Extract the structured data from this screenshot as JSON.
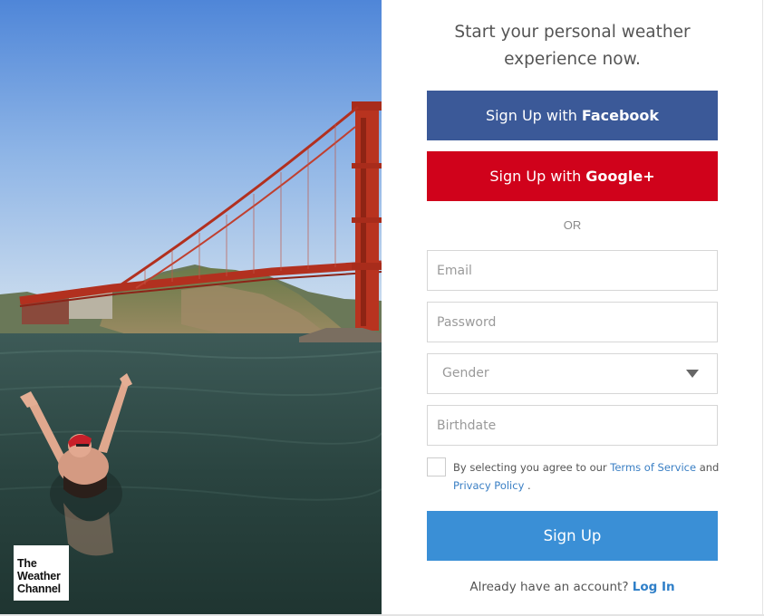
{
  "hero": {
    "brand_lines": [
      "The",
      "Weather",
      "Channel"
    ]
  },
  "signup": {
    "headline_line1": "Start your personal weather",
    "headline_line2": "experience now.",
    "facebook_prefix": "Sign Up with",
    "facebook_name": "Facebook",
    "google_prefix": "Sign Up with",
    "google_name": "Google+",
    "divider": "OR",
    "email_placeholder": "Email",
    "password_placeholder": "Password",
    "gender_value": "Gender",
    "birthdate_placeholder": "Birthdate",
    "terms_prefix": "By selecting you agree to our",
    "terms_link": "Terms of Service",
    "terms_and": "and",
    "privacy_link": "Privacy Policy",
    "terms_suffix": ".",
    "submit_label": "Sign Up",
    "login_prompt": "Already have an account?",
    "login_link": "Log In"
  },
  "colors": {
    "facebook": "#3b5998",
    "google": "#d0021b",
    "primary": "#3a8fd6",
    "link": "#3a7fc4"
  }
}
